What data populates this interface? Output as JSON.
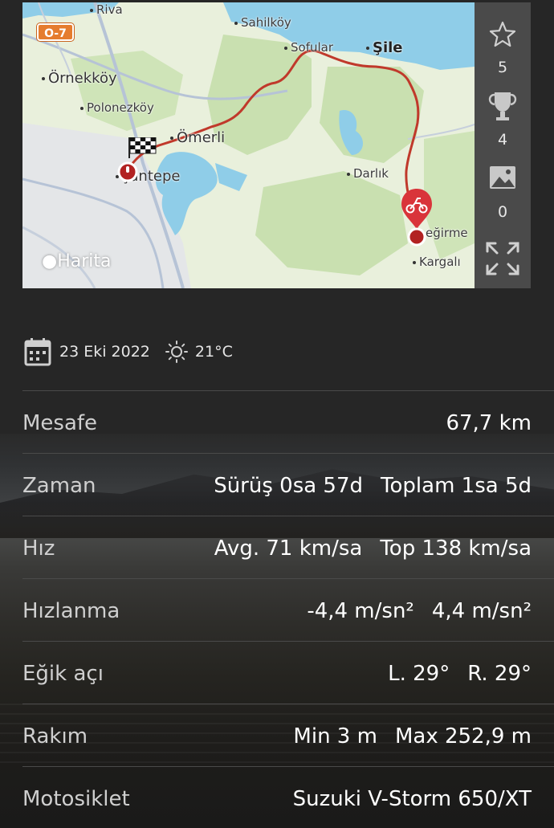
{
  "map": {
    "road_badge": "O-7",
    "places": {
      "riva": "Riva",
      "sahilkoy": "Sahilköy",
      "sofular": "Sofular",
      "sile": "Şile",
      "ornekkoy": "Örnekköy",
      "polonezkoy": "Polonezköy",
      "omerli": "Ömerli",
      "sancaktepe": "şantepe",
      "darlik": "Darlık",
      "degirmen": "eğirme",
      "kargali": "Kargalı"
    },
    "attribution": "Harita",
    "colors": {
      "route": "#c0392b",
      "land": "#e9f0dc",
      "forest": "#c9e0b0",
      "water": "#8fcde8",
      "sea": "#8fcde8",
      "road": "#b6c3d6"
    }
  },
  "side_panel": {
    "favorites_count": "5",
    "trophies_count": "4",
    "photos_count": "0",
    "icons": [
      "star-icon",
      "trophy-icon",
      "image-icon",
      "expand-icon"
    ]
  },
  "ride_info": {
    "date": "23 Eki 2022",
    "temperature": "21°C"
  },
  "stats": [
    {
      "label": "Mesafe",
      "values": [
        "67,7 km"
      ]
    },
    {
      "label": "Zaman",
      "values": [
        "Sürüş 0sa 57d",
        "Toplam 1sa 5d"
      ]
    },
    {
      "label": "Hız",
      "values": [
        "Avg. 71 km/sa",
        "Top 138 km/sa"
      ]
    },
    {
      "label": "Hızlanma",
      "values": [
        "-4,4 m/sn²",
        "4,4 m/sn²"
      ]
    },
    {
      "label": "Eğik açı",
      "values": [
        "L. 29°",
        "R. 29°"
      ]
    },
    {
      "label": "Rakım",
      "values": [
        "Min 3 m",
        "Max 252,9 m"
      ]
    },
    {
      "label": "Motosiklet",
      "values": [
        "Suzuki V-Storm 650/XT"
      ]
    }
  ]
}
